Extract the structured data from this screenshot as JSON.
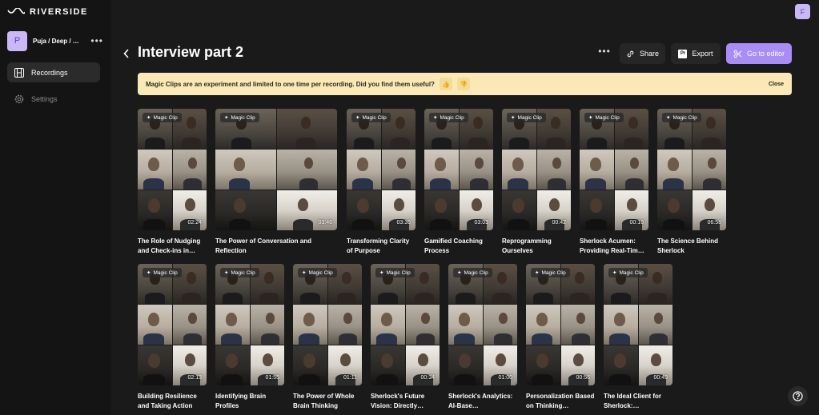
{
  "app": {
    "logo_text": "RIVERSIDE"
  },
  "workspace": {
    "avatar_letter": "P",
    "name": "Puja / Deep / Fei…",
    "more_label": "•••"
  },
  "nav": {
    "recordings": "Recordings",
    "settings": "Settings"
  },
  "user": {
    "avatar_letter": "F"
  },
  "page": {
    "title": "Interview part 2"
  },
  "toolbar": {
    "more_label": "•••",
    "share": "Share",
    "export": "Export",
    "export_icon_text": "Pr",
    "editor": "Go to editor"
  },
  "banner": {
    "text": "Magic Clips are an experiment and limited to one time per recording. Did you find them useful?",
    "thumbs_up": "👍",
    "thumbs_down": "👎",
    "close": "Close"
  },
  "badge_label": "Magic Clip",
  "colors": {
    "accent": "#a98cf5",
    "banner_bg": "#fbe9b5",
    "sidebar_bg": "#141414",
    "page_bg": "#1a1a1a"
  },
  "clips": [
    {
      "duration": "02:24",
      "title": "The Role of Nudging and Check-ins in…"
    },
    {
      "duration": "03:46",
      "title": "The Power of Conversation and Reflection"
    },
    {
      "duration": "03:36",
      "title": "Transforming Clarity of Purpose"
    },
    {
      "duration": "03:03",
      "title": "Gamified Coaching Process"
    },
    {
      "duration": "00:42",
      "title": "Reprogramming Ourselves"
    },
    {
      "duration": "00:16",
      "title": "Sherlock Acumen: Providing Real-Tim…"
    },
    {
      "duration": "06:58",
      "title": "The Science Behind Sherlock"
    },
    {
      "duration": "02:13",
      "title": "Building Resilience and Taking Action"
    },
    {
      "duration": "01:55",
      "title": "Identifying Brain Profiles"
    },
    {
      "duration": "01:11",
      "title": "The Power of Whole Brain Thinking"
    },
    {
      "duration": "00:34",
      "title": "Sherlock's Future Vision: Directly…"
    },
    {
      "duration": "01:00",
      "title": "Sherlock's Analytics: AI-Base…"
    },
    {
      "duration": "00:56",
      "title": "Personalization Based on Thinking…"
    },
    {
      "duration": "00:49",
      "title": "The Ideal Client for Sherlock:…"
    }
  ]
}
